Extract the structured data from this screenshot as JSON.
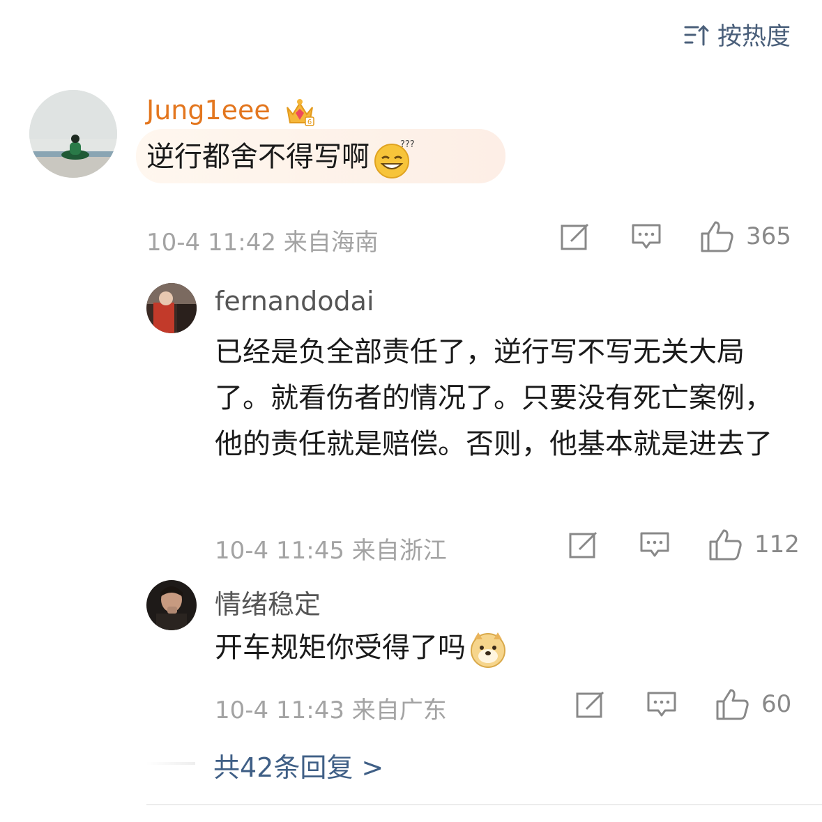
{
  "sort": {
    "label": "按热度",
    "icon": "sort-icon"
  },
  "comments": [
    {
      "username": "Jung1eee",
      "username_color": "#e3761e",
      "badge": "crown-vip-icon",
      "text": "逆行都舍不得写啊",
      "emoji": "grinning-question-emoji",
      "meta": "10-4 11:42 来自海南",
      "likes": "365"
    },
    {
      "username": "fernandodai",
      "username_color": "#555555",
      "text": "已经是负全部责任了，逆行写不写无关大局了。就看伤者的情况了。只要没有死亡案例，他的责任就是赔偿。否则，他基本就是进去了",
      "meta": "10-4 11:45 来自浙江",
      "likes": "112"
    },
    {
      "username": "情绪稳定",
      "username_color": "#555555",
      "text": "开车规矩你受得了吗",
      "emoji": "doge-emoji",
      "meta": "10-4 11:43 来自广东",
      "likes": "60"
    }
  ],
  "more_replies": "共42条回复 >",
  "colors": {
    "link": "#3f5f86",
    "meta": "#a3a3a3",
    "icon": "#888888"
  }
}
